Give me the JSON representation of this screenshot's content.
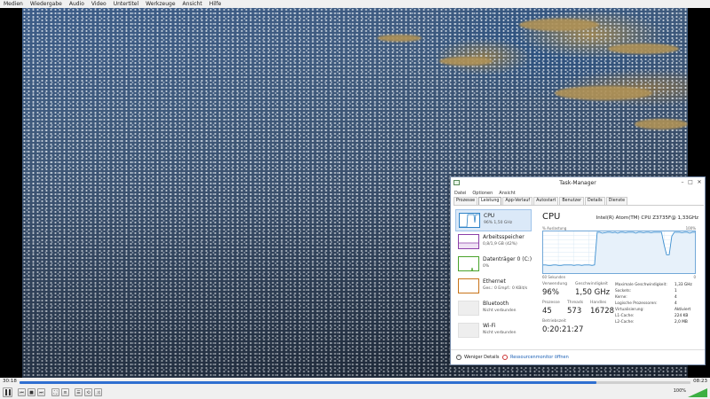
{
  "player": {
    "menu": [
      "Medien",
      "Wiedergabe",
      "Audio",
      "Video",
      "Untertitel",
      "Werkzeuge",
      "Ansicht",
      "Hilfe"
    ],
    "time_elapsed": "30:18",
    "time_total": "08:23",
    "progress_fraction": 0.86,
    "volume_text": "100%",
    "volume_fraction": 1.0,
    "accent": "#2f6fd0"
  },
  "taskmgr": {
    "title": "Task-Manager",
    "window_buttons": [
      "–",
      "□",
      "✕"
    ],
    "menu": [
      "Datei",
      "Optionen",
      "Ansicht"
    ],
    "tabs": [
      "Prozesse",
      "Leistung",
      "App-Verlauf",
      "Autostart",
      "Benutzer",
      "Details",
      "Dienste"
    ],
    "active_tab": "Leistung",
    "sidebar": [
      {
        "title": "CPU",
        "sub": "96% 1,50 GHz",
        "color": "#2f84c8"
      },
      {
        "title": "Arbeitsspeicher",
        "sub": "0,8/1,9 GB (42%)",
        "color": "#8b3fa8"
      },
      {
        "title": "Datenträger 0 (C:)",
        "sub": "0%",
        "color": "#4aa32c"
      },
      {
        "title": "Ethernet",
        "sub": "Ges.: 0 Empf.: 0 KBit/s",
        "color": "#c8741a"
      },
      {
        "title": "Bluetooth",
        "sub": "Nicht verbunden",
        "color": "#999999"
      },
      {
        "title": "Wi-Fi",
        "sub": "Nicht verbunden",
        "color": "#999999"
      }
    ],
    "cpu": {
      "title": "CPU",
      "model": "Intel(R) Atom(TM) CPU Z3735F@ 1,33GHz",
      "graph_caption": "% Auslastung",
      "graph_max": "100%",
      "graph_span": "60 Sekunden",
      "graph_min": "0",
      "usage_series": [
        20,
        20,
        19,
        19,
        20,
        20,
        19,
        19,
        20,
        20,
        20,
        20,
        19,
        20,
        20,
        19,
        20,
        20,
        20,
        19,
        20,
        100,
        100,
        98,
        99,
        100,
        100,
        99,
        100,
        98,
        100,
        100,
        99,
        100,
        100,
        100,
        98,
        100,
        100,
        99,
        100,
        100,
        99,
        100,
        100,
        100,
        100,
        70,
        45,
        45,
        90,
        100,
        100,
        100,
        99,
        100,
        100,
        98,
        100,
        100
      ],
      "stats": {
        "usage_label": "Verwendung",
        "usage": "96%",
        "speed_label": "Geschwindigkeit",
        "speed": "1,50 GHz",
        "processes_label": "Prozesse",
        "processes": "45",
        "threads_label": "Threads",
        "threads": "573",
        "handles_label": "Handles",
        "handles": "16728",
        "uptime_label": "Betriebszeit",
        "uptime": "0:20:21:27"
      },
      "details": [
        {
          "label": "Maximale Geschwindigkeit:",
          "value": "1,33 GHz"
        },
        {
          "label": "Sockets:",
          "value": "1"
        },
        {
          "label": "Kerne:",
          "value": "4"
        },
        {
          "label": "Logische Prozessoren:",
          "value": "4"
        },
        {
          "label": "Virtualisierung:",
          "value": "Aktiviert"
        },
        {
          "label": "L1-Cache:",
          "value": "224 KB"
        },
        {
          "label": "L2-Cache:",
          "value": "2,0 MB"
        }
      ]
    },
    "footer": {
      "fewer_details": "Weniger Details",
      "resource_monitor": "Ressourcenmonitor öffnen"
    }
  }
}
